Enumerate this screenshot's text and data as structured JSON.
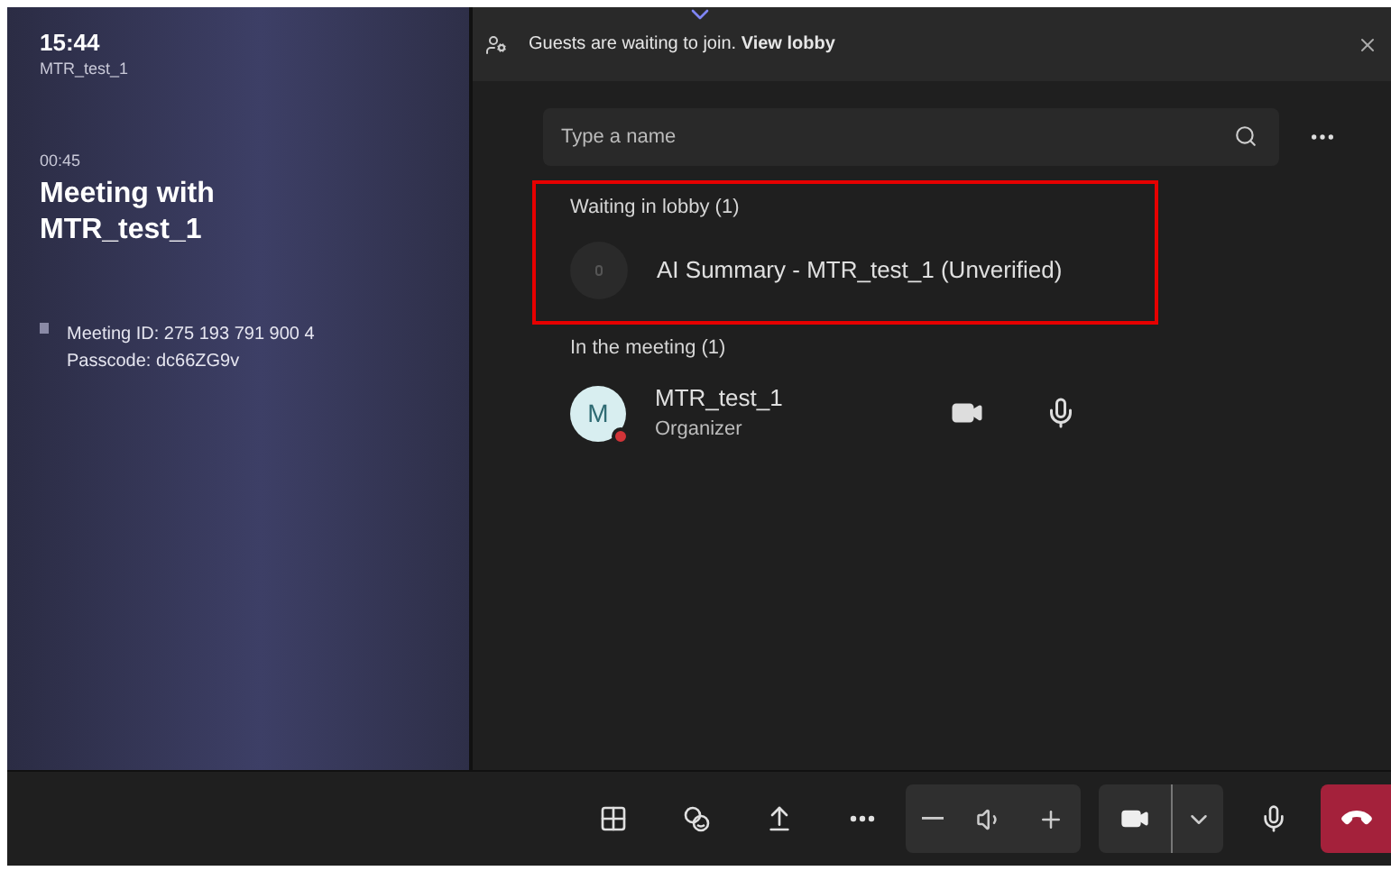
{
  "info_panel": {
    "time": "15:44",
    "room": "MTR_test_1",
    "duration": "00:45",
    "title": "Meeting with MTR_test_1",
    "meeting_id": "Meeting ID:  275 193 791 900 4",
    "passcode": "Passcode: dc66ZG9v"
  },
  "banner": {
    "text": "Guests are waiting to join. **View lobby**"
  },
  "search": {
    "placeholder": "Type a name"
  },
  "sections": [
    {
      "heading": "Waiting in lobby (1)",
      "highlighted": true,
      "people": [
        {
          "name": "AI Summary - MTR_test_1 (Unverified)",
          "kind": "guest"
        }
      ]
    },
    {
      "heading": "In the meeting (1)",
      "highlighted": false,
      "people": [
        {
          "name": "MTR_test_1",
          "role": "Organizer",
          "initial": "M",
          "kind": "member"
        }
      ]
    }
  ]
}
